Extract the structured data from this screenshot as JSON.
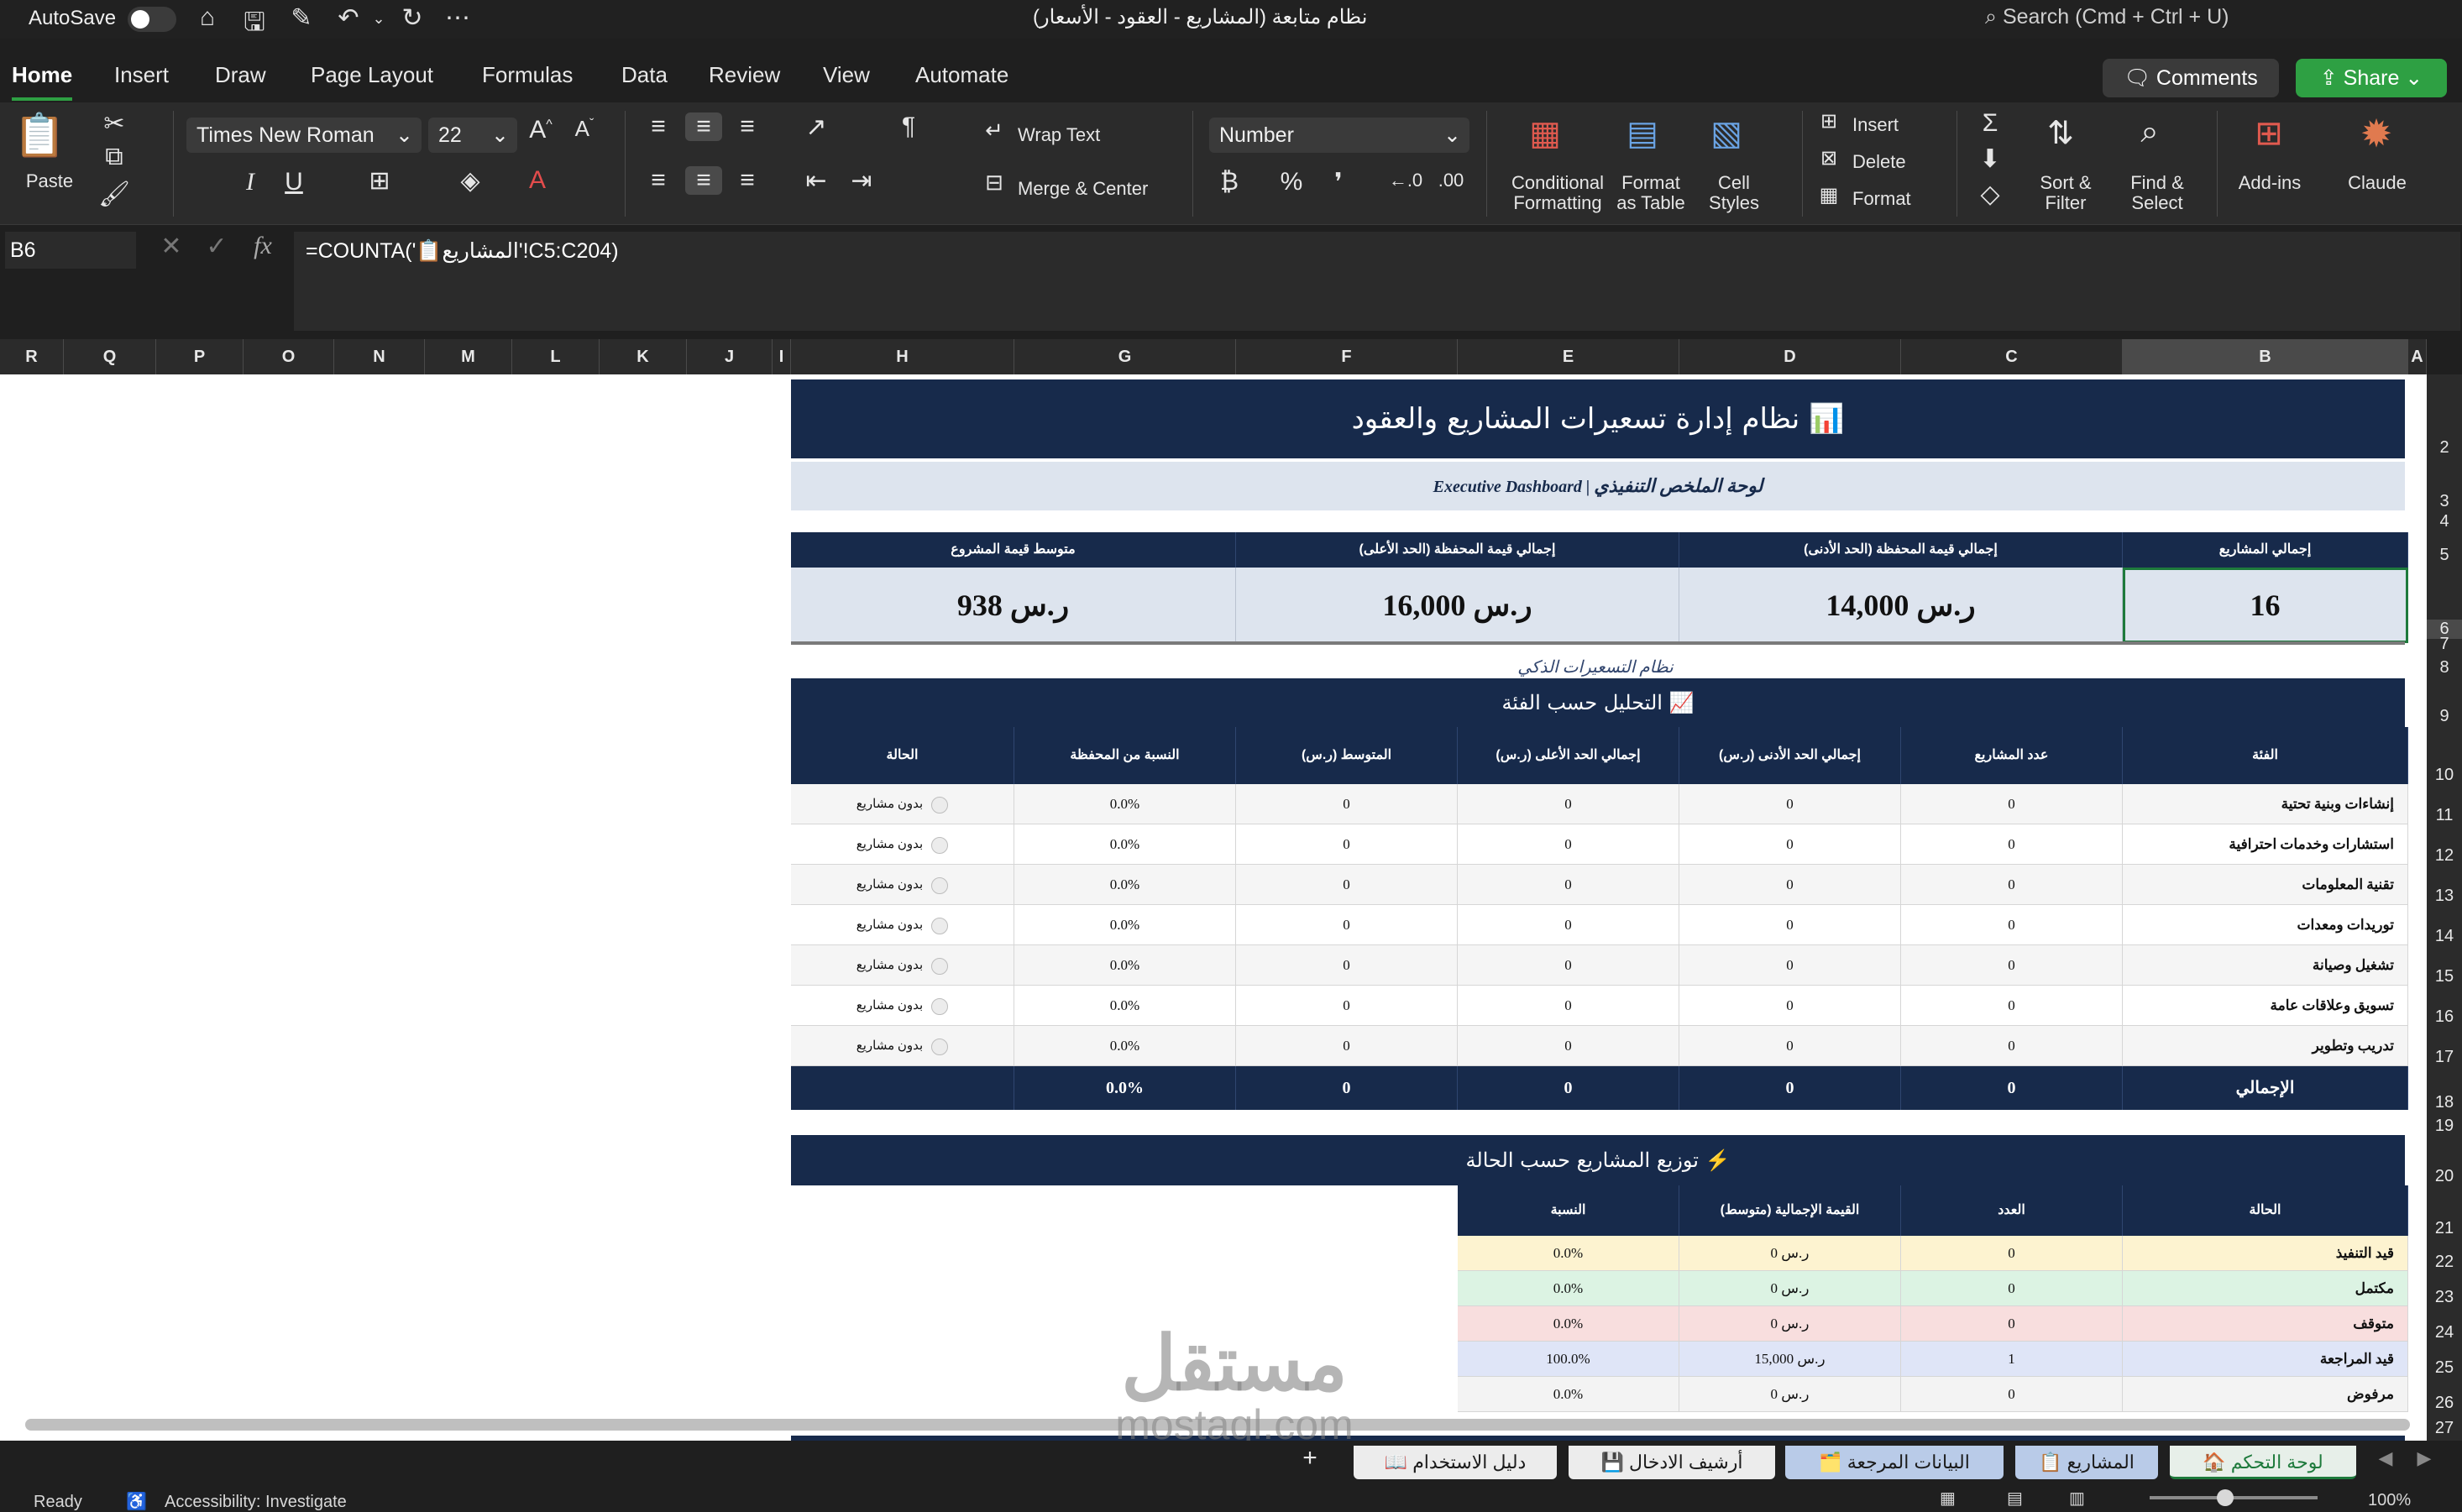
{
  "titlebar": {
    "autosave_label": "AutoSave",
    "document_title": "نظام متابعة (المشاريع - العقود - الأسعار)",
    "search_placeholder": "Search (Cmd + Ctrl + U)"
  },
  "ribbon_tabs": [
    "Home",
    "Insert",
    "Draw",
    "Page Layout",
    "Formulas",
    "Data",
    "Review",
    "View",
    "Automate"
  ],
  "header_buttons": {
    "comments": "Comments",
    "share": "Share"
  },
  "ribbon": {
    "paste": "Paste",
    "font_name": "Times New Roman",
    "font_size": "22",
    "wrap_text": "Wrap Text",
    "merge_center": "Merge & Center",
    "number_format": "Number",
    "conditional_formatting": [
      "Conditional",
      "Formatting"
    ],
    "format_as_table": [
      "Format",
      "as Table"
    ],
    "cell_styles": [
      "Cell",
      "Styles"
    ],
    "insert": "Insert",
    "delete": "Delete",
    "format": "Format",
    "sort_filter": [
      "Sort &",
      "Filter"
    ],
    "find_select": [
      "Find &",
      "Select"
    ],
    "add_ins": "Add-ins",
    "claude": "Claude"
  },
  "formula_bar": {
    "name_box": "B6",
    "formula": "=COUNTA('📋المشاريع'!C5:C204)"
  },
  "columns": [
    "R",
    "Q",
    "P",
    "O",
    "N",
    "M",
    "L",
    "K",
    "J",
    "I",
    "H",
    "G",
    "F",
    "E",
    "D",
    "C",
    "B",
    "A"
  ],
  "rows": [
    "2",
    "3",
    "4",
    "5",
    "6",
    "7",
    "8",
    "9",
    "10",
    "11",
    "12",
    "13",
    "14",
    "15",
    "16",
    "17",
    "18",
    "19",
    "20",
    "21",
    "22",
    "23",
    "24",
    "25",
    "26",
    "27"
  ],
  "dashboard": {
    "title": "نظام إدارة تسعيرات المشاريع والعقود 📊",
    "subtitle_ar": "لوحة الملخص التنفيذي",
    "subtitle_sep": "|",
    "subtitle_en": "Executive Dashboard",
    "kpi_headers": [
      "إجمالي المشاريع",
      "إجمالي قيمة المحفظة (الحد الأدنى)",
      "إجمالي قيمة المحفظة (الحد الأعلى)",
      "متوسط قيمة المشروع"
    ],
    "kpi_values": [
      "16",
      "14,000 ر.س",
      "16,000 ر.س",
      "938 ر.س"
    ],
    "smart_note": "نظام التسعيرات الذكي",
    "category_title": "التحليل حسب الفئة 📈",
    "category_headers": [
      "الفئة",
      "عدد المشاريع",
      "إجمالي الحد الأدنى (ر.س)",
      "إجمالي الحد الأعلى (ر.س)",
      "المتوسط (ر.س)",
      "النسبة من المحفظة",
      "الحالة"
    ],
    "category_rows": [
      [
        "إنشاءات وبنية تحتية",
        "0",
        "0",
        "0",
        "0",
        "0.0%",
        "بدون مشاريع"
      ],
      [
        "استشارات وخدمات احترافية",
        "0",
        "0",
        "0",
        "0",
        "0.0%",
        "بدون مشاريع"
      ],
      [
        "تقنية المعلومات",
        "0",
        "0",
        "0",
        "0",
        "0.0%",
        "بدون مشاريع"
      ],
      [
        "توريدات ومعدات",
        "0",
        "0",
        "0",
        "0",
        "0.0%",
        "بدون مشاريع"
      ],
      [
        "تشغيل وصيانة",
        "0",
        "0",
        "0",
        "0",
        "0.0%",
        "بدون مشاريع"
      ],
      [
        "تسويق وعلاقات عامة",
        "0",
        "0",
        "0",
        "0",
        "0.0%",
        "بدون مشاريع"
      ],
      [
        "تدريب وتطوير",
        "0",
        "0",
        "0",
        "0",
        "0.0%",
        "بدون مشاريع"
      ]
    ],
    "category_total": [
      "الإجمالي",
      "0",
      "0",
      "0",
      "0",
      "0.0%"
    ],
    "status_title": "توزيع المشاريع حسب الحالة ⚡",
    "status_headers": [
      "الحالة",
      "العدد",
      "القيمة الإجمالية (متوسط)",
      "النسبة"
    ],
    "status_rows": [
      [
        "قيد التنفيذ",
        "0",
        "ر.س 0",
        "0.0%"
      ],
      [
        "مكتمل",
        "0",
        "ر.س 0",
        "0.0%"
      ],
      [
        "متوقف",
        "0",
        "ر.س 0",
        "0.0%"
      ],
      [
        "قيد المراجعة",
        "1",
        "ر.س 15,000",
        "100.0%"
      ],
      [
        "مرفوض",
        "0",
        "ر.س 0",
        "0.0%"
      ]
    ],
    "status_colors": [
      "#fdf3d0",
      "#dcf3e3",
      "#f8dede",
      "#dfe5f7",
      "#f3f3f3"
    ]
  },
  "sheet_tabs": [
    "🏠 لوحة التحكم",
    "📋 المشاريع",
    "🗂️ البيانات المرجعة",
    "💾 أرشيف الادخال",
    "📖 دليل الاستخدام"
  ],
  "statusbar": {
    "ready": "Ready",
    "accessibility": "Accessibility: Investigate",
    "zoom": "100%"
  },
  "watermark": {
    "ar": "مستقل",
    "en": "mostaql.com"
  }
}
